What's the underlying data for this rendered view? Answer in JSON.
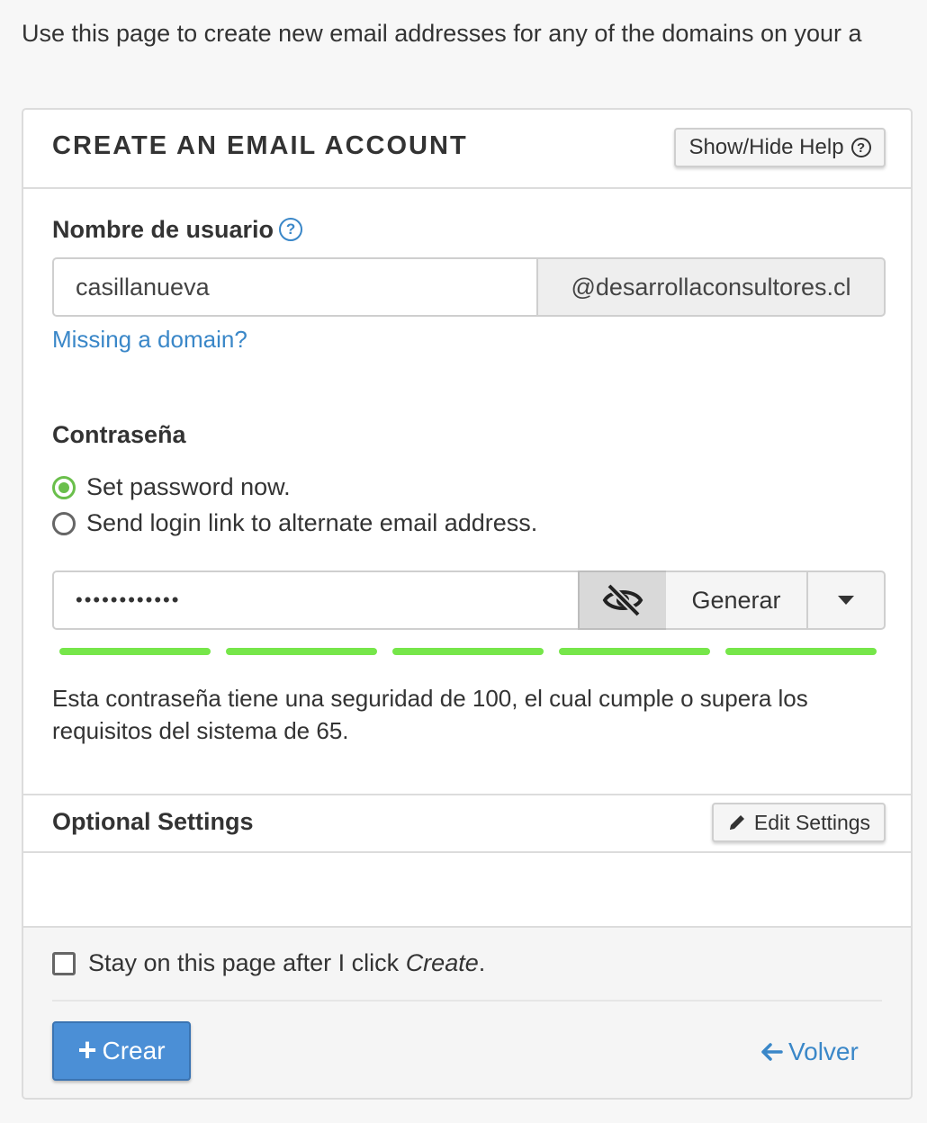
{
  "intro_text": "Use this page to create new email addresses for any of the domains on your a",
  "panel": {
    "title": "CREATE AN EMAIL ACCOUNT",
    "help_button": "Show/Hide Help"
  },
  "username": {
    "label": "Nombre de usuario",
    "value": "casillanueva",
    "domain": "@desarrollaconsultores.cl",
    "missing_domain_link": "Missing a domain?"
  },
  "password": {
    "label": "Contraseña",
    "options": [
      {
        "label": "Set password now.",
        "checked": true
      },
      {
        "label": "Send login link to alternate email address.",
        "checked": false
      }
    ],
    "masked_value": "••••••••••••",
    "generate_label": "Generar",
    "strength_segments": 5,
    "strength_color": "#76e64a",
    "strength_text": "Esta contraseña tiene una seguridad de 100, el cual cumple o supera los requisitos del sistema de 65."
  },
  "optional_settings": {
    "title": "Optional Settings",
    "edit_button": "Edit Settings"
  },
  "footer": {
    "stay_text_before": "Stay on this page after I click ",
    "stay_text_italic": "Create",
    "stay_text_after": ".",
    "create_button": "Crear",
    "back_link": "Volver"
  },
  "colors": {
    "accent": "#3a87c8",
    "primary_button": "#4b8fd6",
    "radio_checked": "#6abf4b"
  }
}
